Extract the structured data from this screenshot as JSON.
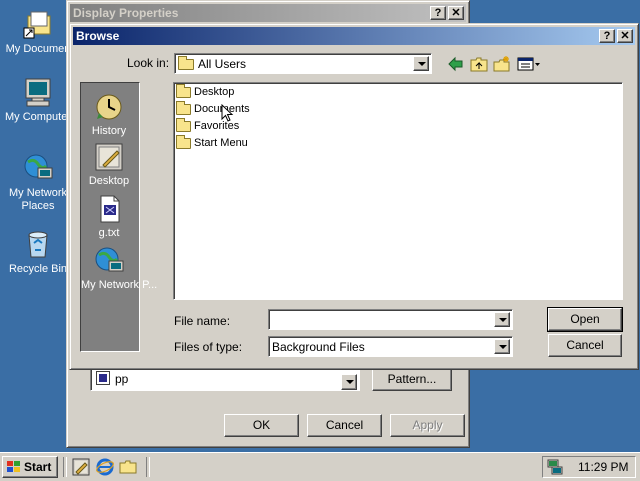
{
  "desktop": {
    "icons": [
      {
        "label": "My Documen",
        "icon": "my-documents-icon"
      },
      {
        "label": "My Computer",
        "icon": "my-computer-icon"
      },
      {
        "label": "My Network Places",
        "line1": "My Network",
        "line2": "Places",
        "icon": "network-places-icon"
      },
      {
        "label": "Recycle Bin",
        "icon": "recycle-bin-icon"
      }
    ]
  },
  "display_properties": {
    "title": "Display Properties",
    "pattern_value": "pp",
    "pattern_button": "Pattern...",
    "ok": "OK",
    "cancel": "Cancel",
    "apply": "Apply",
    "help_button": "?",
    "close_button": "✕"
  },
  "browse": {
    "title": "Browse",
    "help_button": "?",
    "close_button": "✕",
    "look_in_label": "Look in:",
    "look_in_value": "All Users",
    "places": [
      {
        "label": "History",
        "icon": "history-icon"
      },
      {
        "label": "Desktop",
        "icon": "desktop-icon"
      },
      {
        "label": "g.txt",
        "icon": "file-icon"
      },
      {
        "label": "My Network P...",
        "icon": "network-places-icon"
      }
    ],
    "files": [
      {
        "name": "Desktop"
      },
      {
        "name": "Documents"
      },
      {
        "name": "Favorites"
      },
      {
        "name": "Start Menu"
      }
    ],
    "file_name_label": "File name:",
    "file_name_value": "",
    "files_of_type_label": "Files of type:",
    "files_of_type_value": "Background Files",
    "open_button": "Open",
    "cancel_button": "Cancel"
  },
  "taskbar": {
    "start_label": "Start",
    "clock": "11:29 PM"
  }
}
